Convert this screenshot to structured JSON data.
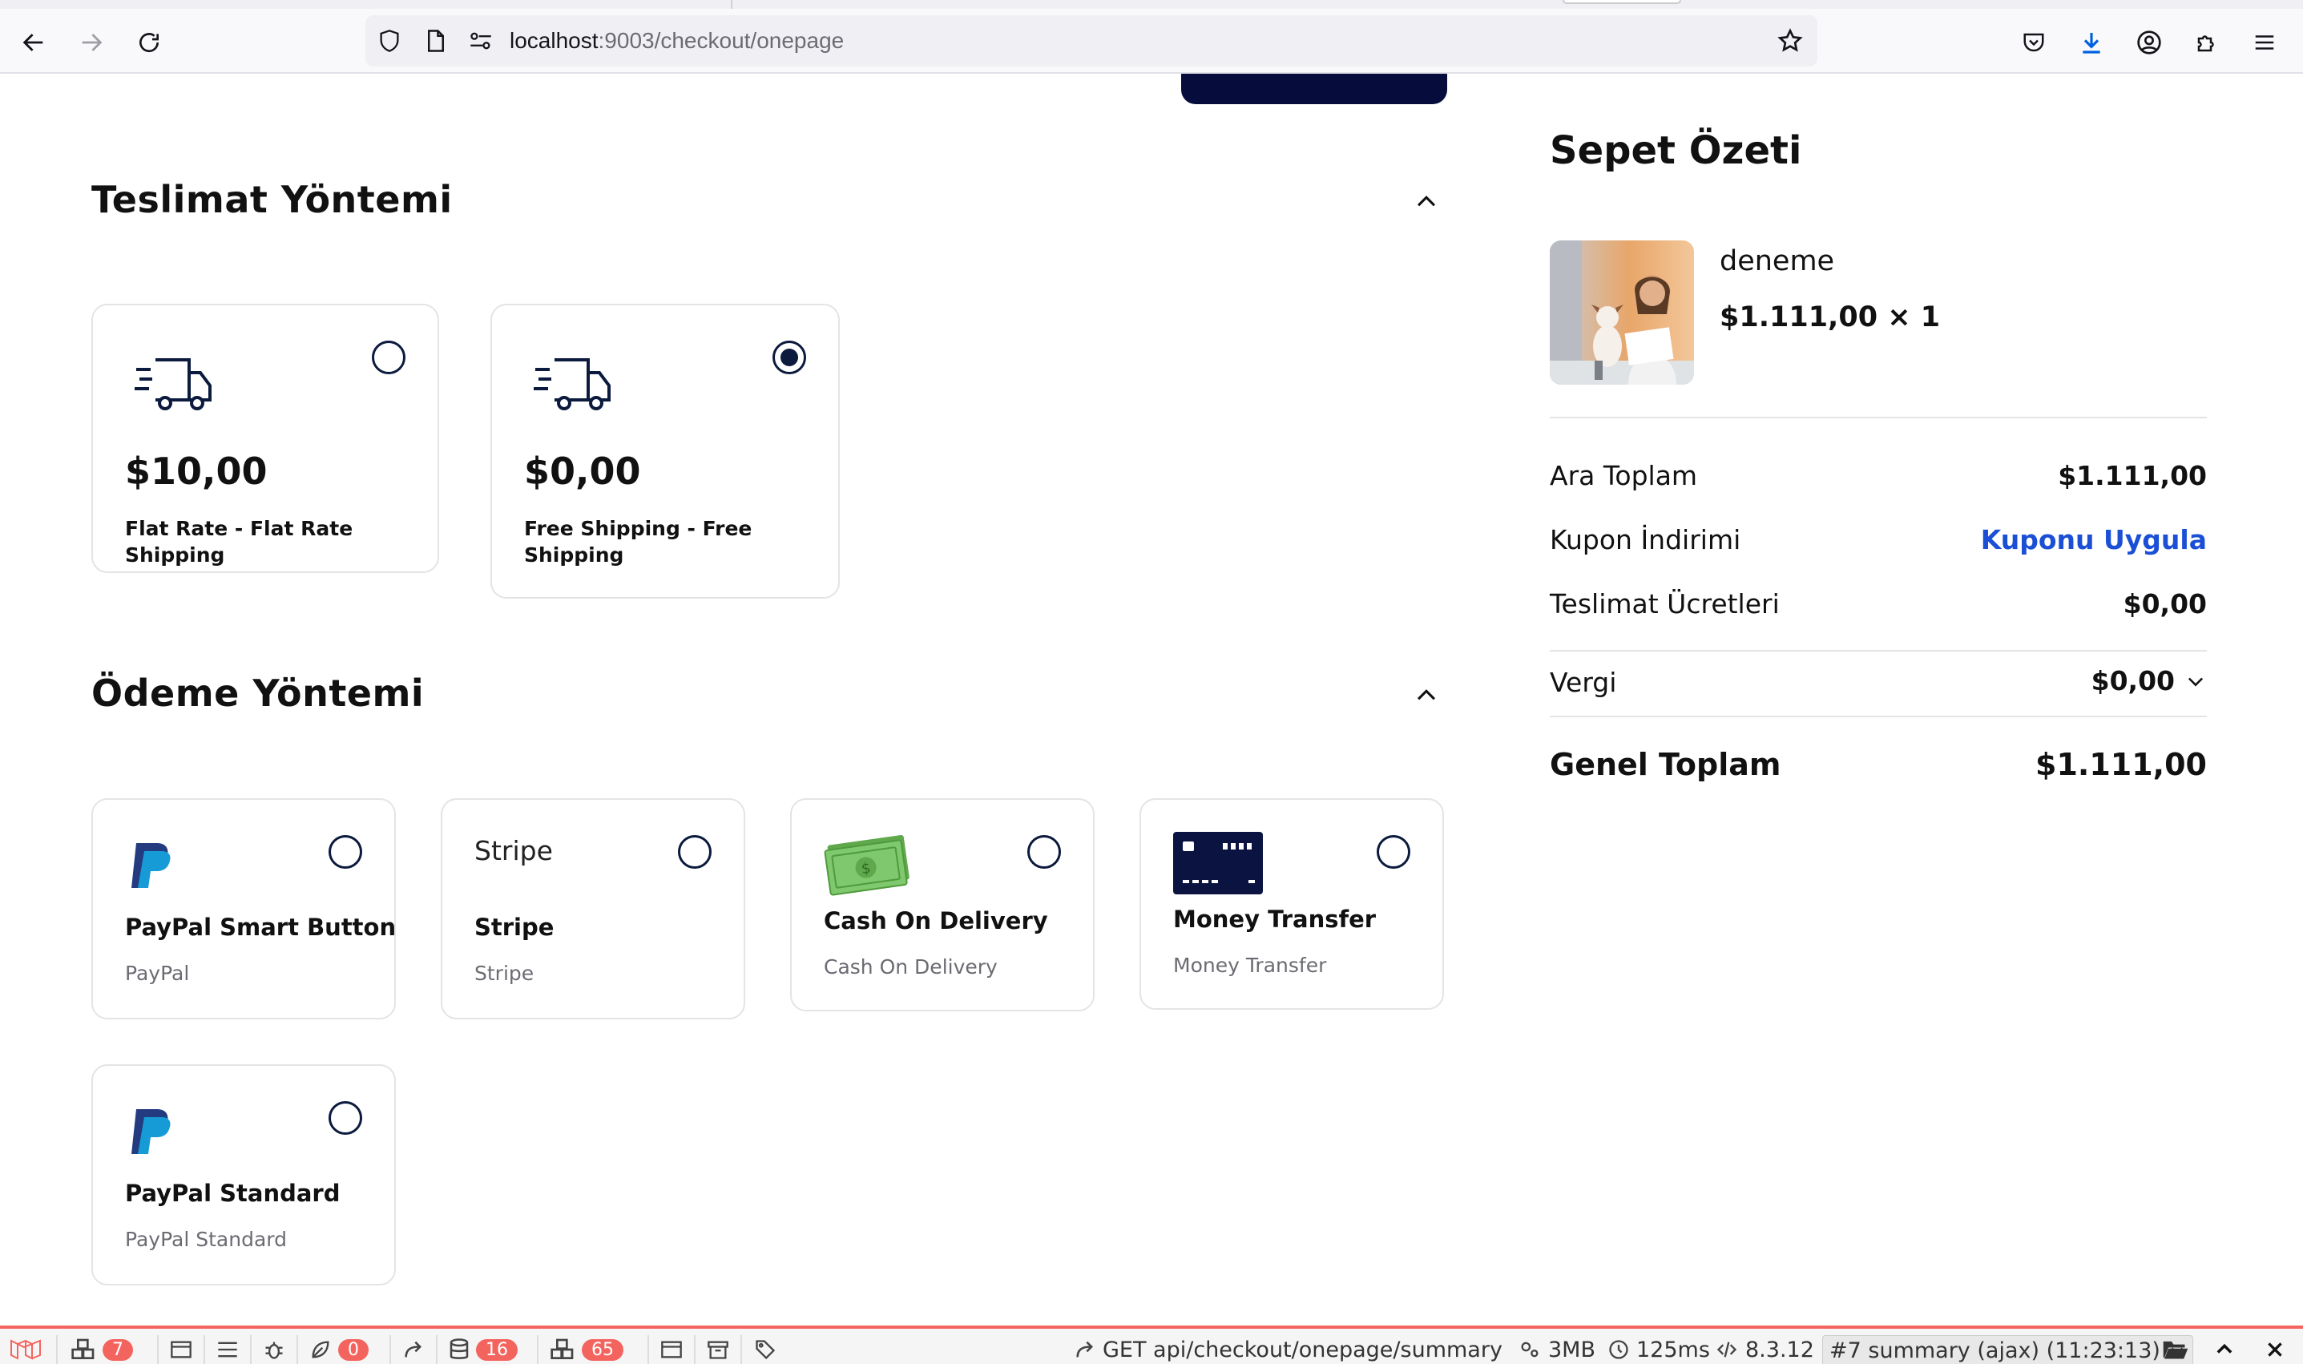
{
  "browser": {
    "url_host": "localhost",
    "url_path": ":9003/checkout/onepage"
  },
  "shipping": {
    "title": "Teslimat Yöntemi",
    "options": [
      {
        "price": "$10,00",
        "desc": "Flat Rate - Flat Rate Shipping",
        "selected": false
      },
      {
        "price": "$0,00",
        "desc": "Free Shipping - Free Shipping",
        "selected": true
      }
    ]
  },
  "payment": {
    "title": "Ödeme Yöntemi",
    "options": [
      {
        "logo": "paypal-logo-icon",
        "title": "PayPal Smart Button",
        "sub": "PayPal"
      },
      {
        "logo_text": "Stripe",
        "title": "Stripe",
        "sub": "Stripe"
      },
      {
        "logo": "cash-icon",
        "title": "Cash On Delivery",
        "sub": "Cash On Delivery"
      },
      {
        "logo": "credit-card-icon",
        "title": "Money Transfer",
        "sub": "Money Transfer"
      },
      {
        "logo": "paypal-logo-icon",
        "title": "PayPal Standard",
        "sub": "PayPal Standard"
      }
    ]
  },
  "summary": {
    "title": "Sepet Özeti",
    "product": {
      "name": "deneme",
      "price_qty": "$1.111,00 × 1"
    },
    "rows": [
      {
        "label": "Ara Toplam",
        "value": "$1.111,00"
      },
      {
        "label": "Kupon İndirimi",
        "value": "Kuponu Uygula"
      },
      {
        "label": "Teslimat Ücretleri",
        "value": "$0,00"
      },
      {
        "label": "Vergi",
        "value": "$0,00"
      },
      {
        "label": "Genel Toplam",
        "value": "$1.111,00"
      }
    ]
  },
  "debugbar": {
    "badges": {
      "messages": "7",
      "exceptions": "0",
      "queries": "16",
      "models": "65"
    },
    "request": "GET api/checkout/onepage/summary",
    "memory": "3MB",
    "time": "125ms",
    "php": "8.3.12",
    "selected_request": "#7 summary (ajax) (11:23:13)"
  },
  "colors": {
    "primary": "#060c3b",
    "link": "#1a4fd6",
    "debug_accent": "#f4645f",
    "cash_green": "#7fc86e"
  }
}
